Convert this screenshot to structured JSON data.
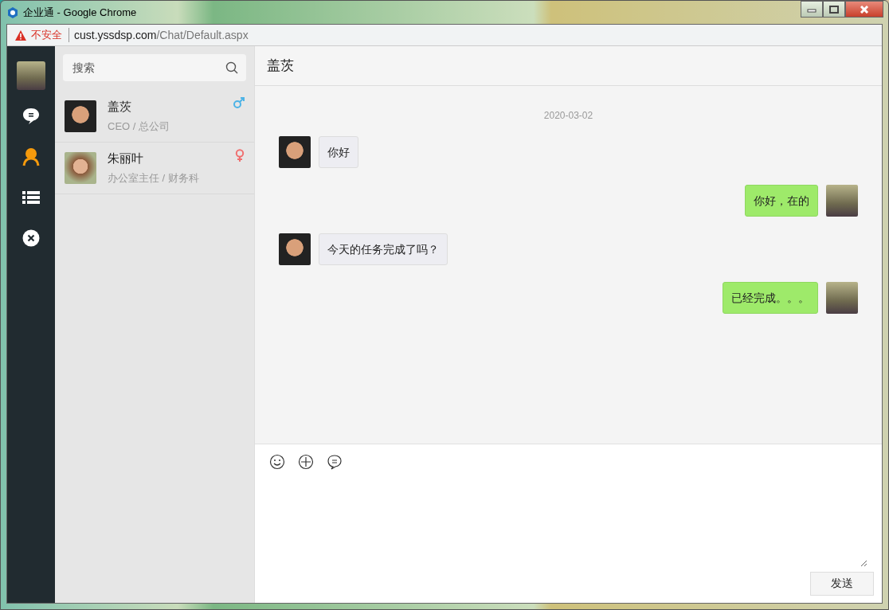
{
  "window": {
    "title": "企业通 - Google Chrome"
  },
  "address_bar": {
    "security_label": "不安全",
    "url_host": "cust.yssdsp.com",
    "url_path": "/Chat/Default.aspx"
  },
  "nav": [
    {
      "kind": "avatar"
    },
    {
      "kind": "chat",
      "selected": false
    },
    {
      "kind": "contacts",
      "selected": true
    },
    {
      "kind": "list",
      "selected": false
    },
    {
      "kind": "close",
      "selected": false
    }
  ],
  "search": {
    "placeholder": "搜索"
  },
  "contacts": [
    {
      "name": "盖茨",
      "subtitle": "CEO / 总公司",
      "kind": "male"
    },
    {
      "name": "朱丽叶",
      "subtitle": "办公室主任 / 财务科",
      "kind": "female"
    }
  ],
  "chat": {
    "title": "盖茨",
    "date": "2020-03-02",
    "messages": [
      {
        "kind": "received",
        "text": "你好"
      },
      {
        "kind": "sent",
        "text": "你好，在的"
      },
      {
        "kind": "received",
        "text": "今天的任务完成了吗？"
      },
      {
        "kind": "sent",
        "text": "已经完成。。。"
      }
    ],
    "toolbar": [
      {
        "kind": "emoji"
      },
      {
        "kind": "add"
      },
      {
        "kind": "chat"
      }
    ],
    "send_button": "发送"
  }
}
